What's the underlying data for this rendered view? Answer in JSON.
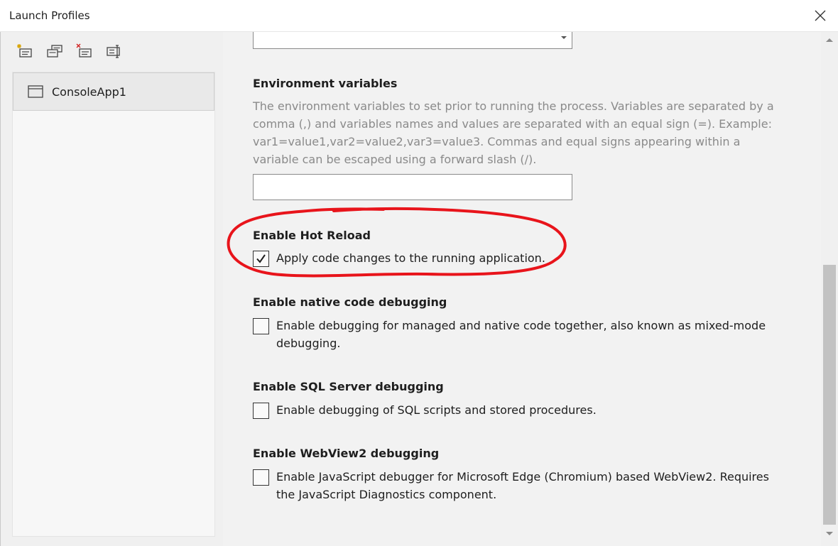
{
  "window": {
    "title": "Launch Profiles"
  },
  "toolbar": {
    "buttons": [
      {
        "name": "new-profile",
        "icon": "new-profile-icon"
      },
      {
        "name": "duplicate-profile",
        "icon": "duplicate-profile-icon"
      },
      {
        "name": "delete-profile",
        "icon": "delete-profile-icon"
      },
      {
        "name": "rename-profile",
        "icon": "rename-profile-icon"
      }
    ]
  },
  "profiles": [
    {
      "label": "ConsoleApp1",
      "icon": "window-icon",
      "selected": true
    }
  ],
  "settings": {
    "dropdown_value": "",
    "env_vars": {
      "title": "Environment variables",
      "description": "The environment variables to set prior to running the process. Variables are separated by a comma (,) and variables names and values are separated with an equal sign (=). Example: var1=value1,var2=value2,var3=value3. Commas and equal signs appearing within a variable can be escaped using a forward slash (/).",
      "value": ""
    },
    "hot_reload": {
      "title": "Enable Hot Reload",
      "label": "Apply code changes to the running application.",
      "checked": true
    },
    "native_debugging": {
      "title": "Enable native code debugging",
      "label": "Enable debugging for managed and native code together, also known as mixed-mode debugging.",
      "checked": false
    },
    "sql_debugging": {
      "title": "Enable SQL Server debugging",
      "label": "Enable debugging of SQL scripts and stored procedures.",
      "checked": false
    },
    "webview2_debugging": {
      "title": "Enable WebView2 debugging",
      "label": "Enable JavaScript debugger for Microsoft Edge (Chromium) based WebView2. Requires the JavaScript Diagnostics component.",
      "checked": false
    }
  },
  "colors": {
    "annotation": "#e8141b",
    "description_text": "#8a8a8a",
    "scrollbar_thumb": "#c2c2c2"
  }
}
